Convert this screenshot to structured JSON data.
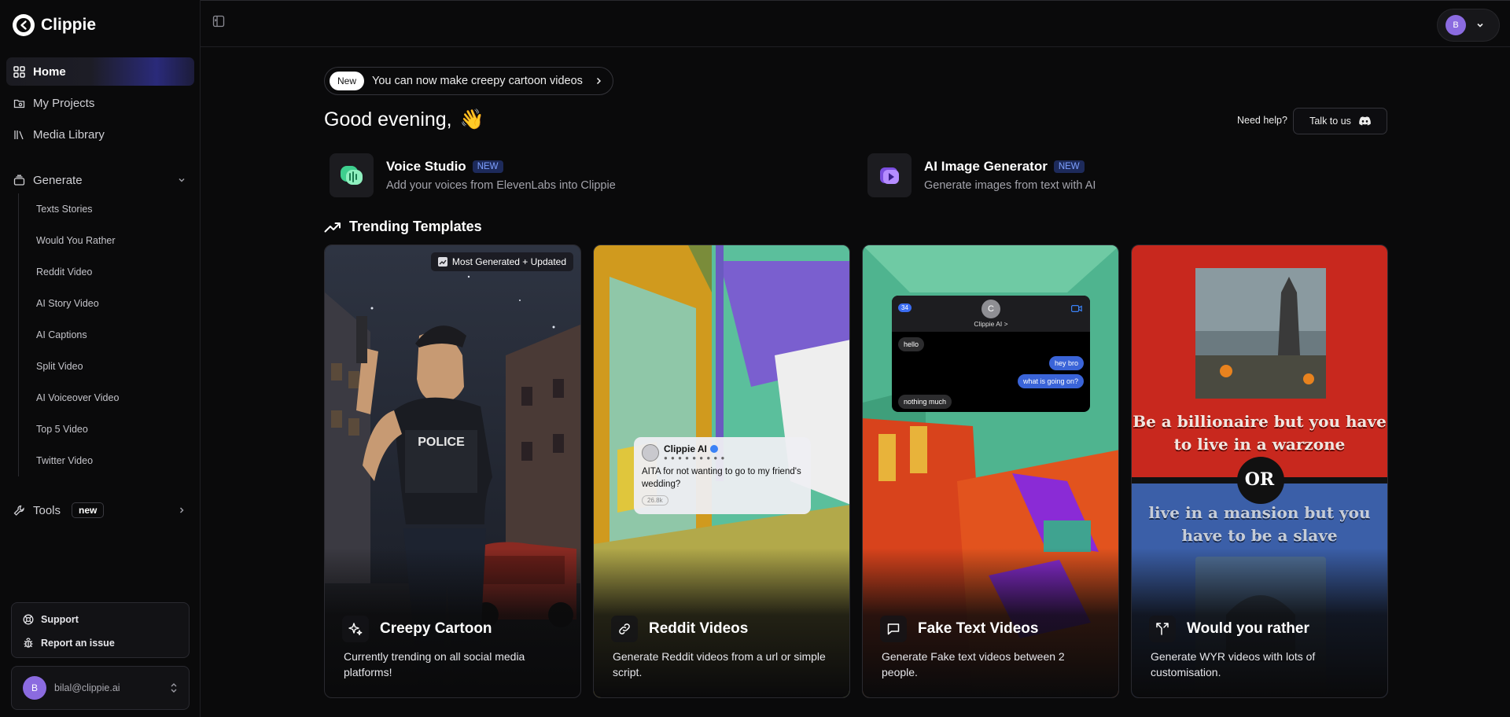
{
  "app": {
    "name": "Clippie"
  },
  "sidebar": {
    "nav": [
      {
        "label": "Home",
        "icon": "grid-icon",
        "active": true
      },
      {
        "label": "My Projects",
        "icon": "folder-icon"
      },
      {
        "label": "Media Library",
        "icon": "library-icon"
      }
    ],
    "generate": {
      "label": "Generate",
      "items": [
        "Texts Stories",
        "Would You Rather",
        "Reddit Video",
        "AI Story Video",
        "AI Captions",
        "Split Video",
        "AI Voiceover Video",
        "Top 5 Video",
        "Twitter Video"
      ]
    },
    "tools": {
      "label": "Tools",
      "badge": "new"
    },
    "support": {
      "support_label": "Support",
      "report_label": "Report an issue"
    },
    "user": {
      "avatar_initial": "B",
      "email": "bilal@clippie.ai"
    }
  },
  "topbar": {
    "avatar_initial": "B"
  },
  "announcement": {
    "badge": "New",
    "text": "You can now make creepy cartoon videos"
  },
  "greeting": {
    "text": "Good evening,",
    "emoji": "👋"
  },
  "help": {
    "label": "Need help?",
    "button": "Talk to us"
  },
  "features": [
    {
      "title": "Voice Studio",
      "badge": "NEW",
      "desc": "Add your voices from ElevenLabs into Clippie"
    },
    {
      "title": "AI Image Generator",
      "badge": "NEW",
      "desc": "Generate images from text with AI"
    }
  ],
  "trending": {
    "title": "Trending Templates",
    "cards": [
      {
        "title": "Creepy Cartoon",
        "desc": "Currently trending on all social media platforms!",
        "tag": "Most Generated + Updated"
      },
      {
        "title": "Reddit Videos",
        "desc": "Generate Reddit videos from a url or simple script.",
        "post": {
          "author": "Clippie AI",
          "text": "AITA for not wanting to go to my friend's wedding?",
          "count": "26.8k"
        }
      },
      {
        "title": "Fake Text Videos",
        "desc": "Generate Fake text videos between 2 people.",
        "chat": {
          "back_count": "34",
          "contact_initial": "C",
          "contact_name": "Clippie AI >",
          "messages": [
            "hello",
            "hey bro",
            "what is going on?",
            "nothing much"
          ]
        }
      },
      {
        "title": "Would you rather",
        "desc": "Generate WYR videos with lots of customisation.",
        "wyr": {
          "option_a": "Be a billionaire but you have to live in a warzone",
          "or_label": "OR",
          "option_b": "live in a mansion but you have to be a slave"
        }
      }
    ]
  },
  "colors": {
    "accent": "#2a2a7a",
    "new_badge_bg": "#1d2a5a",
    "new_badge_text": "#7ea0ff",
    "avatar": "#8b6be0"
  }
}
